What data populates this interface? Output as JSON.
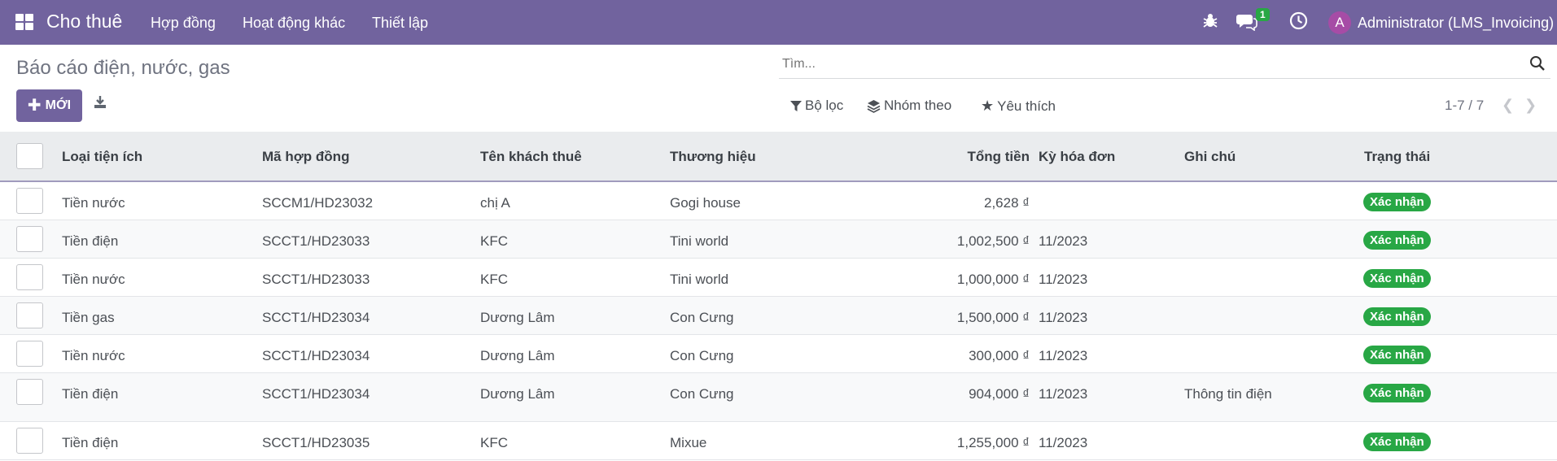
{
  "navbar": {
    "brand": "Cho thuê",
    "menus": [
      "Hợp đồng",
      "Hoạt động khác",
      "Thiết lập"
    ],
    "message_count": "1",
    "avatar_letter": "A",
    "user": "Administrator (LMS_Invoicing)"
  },
  "control": {
    "title": "Báo cáo điện, nước, gas",
    "new_label": "MỚI",
    "search_placeholder": "Tìm...",
    "filter_label": "Bộ lọc",
    "group_label": "Nhóm theo",
    "favorite_label": "Yêu thích",
    "pager": "1-7 / 7"
  },
  "table": {
    "headers": [
      "Loại tiện ích",
      "Mã hợp đồng",
      "Tên khách thuê",
      "Thương hiệu",
      "Tổng tiền",
      "Kỳ hóa đơn",
      "Ghi chú",
      "Trạng thái"
    ],
    "rows": [
      {
        "type": "Tiền nước",
        "contract": "SCCM1/HD23032",
        "tenant": "chị A",
        "brand": "Gogi house",
        "total": "2,628 ₫",
        "period": "",
        "note": "",
        "status": "Xác nhận"
      },
      {
        "type": "Tiền điện",
        "contract": "SCCT1/HD23033",
        "tenant": "KFC",
        "brand": "Tini world",
        "total": "1,002,500 ₫",
        "period": "11/2023",
        "note": "",
        "status": "Xác nhận"
      },
      {
        "type": "Tiền nước",
        "contract": "SCCT1/HD23033",
        "tenant": "KFC",
        "brand": "Tini world",
        "total": "1,000,000 ₫",
        "period": "11/2023",
        "note": "",
        "status": "Xác nhận"
      },
      {
        "type": "Tiền gas",
        "contract": "SCCT1/HD23034",
        "tenant": "Dương Lâm",
        "brand": "Con Cưng",
        "total": "1,500,000 ₫",
        "period": "11/2023",
        "note": "",
        "status": "Xác nhận"
      },
      {
        "type": "Tiền nước",
        "contract": "SCCT1/HD23034",
        "tenant": "Dương Lâm",
        "brand": "Con Cưng",
        "total": "300,000 ₫",
        "period": "11/2023",
        "note": "",
        "status": "Xác nhận"
      },
      {
        "type": "Tiền điện",
        "contract": "SCCT1/HD23034",
        "tenant": "Dương Lâm",
        "brand": "Con Cưng",
        "total": "904,000 ₫",
        "period": "11/2023",
        "note": "Thông tin điện",
        "status": "Xác nhận"
      },
      {
        "type": "Tiền điện",
        "contract": "SCCT1/HD23035",
        "tenant": "KFC",
        "brand": "Mixue",
        "total": "1,255,000 ₫",
        "period": "11/2023",
        "note": "",
        "status": "Xác nhận"
      }
    ]
  },
  "colors": {
    "navbar": "#71639e",
    "status": "#28a745",
    "avatar": "#a64ca6"
  }
}
